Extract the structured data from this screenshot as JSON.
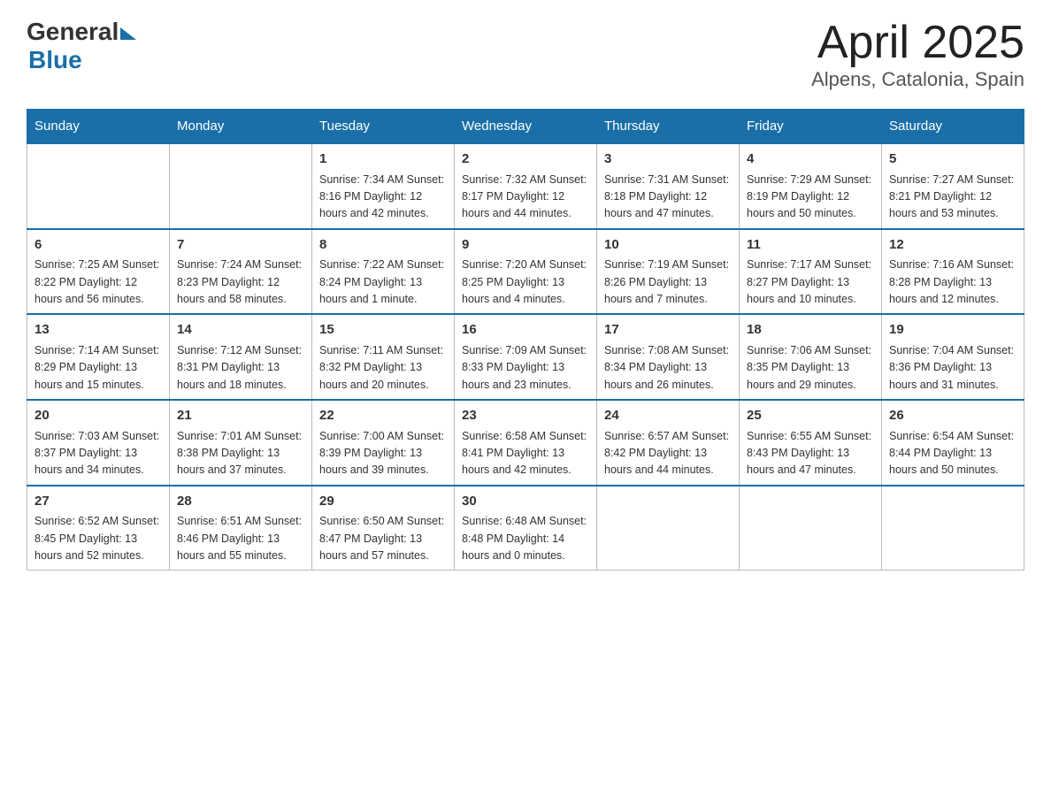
{
  "header": {
    "logo_general": "General",
    "logo_blue": "Blue",
    "title": "April 2025",
    "subtitle": "Alpens, Catalonia, Spain"
  },
  "days_of_week": [
    "Sunday",
    "Monday",
    "Tuesday",
    "Wednesday",
    "Thursday",
    "Friday",
    "Saturday"
  ],
  "weeks": [
    [
      {
        "num": "",
        "info": ""
      },
      {
        "num": "",
        "info": ""
      },
      {
        "num": "1",
        "info": "Sunrise: 7:34 AM\nSunset: 8:16 PM\nDaylight: 12 hours\nand 42 minutes."
      },
      {
        "num": "2",
        "info": "Sunrise: 7:32 AM\nSunset: 8:17 PM\nDaylight: 12 hours\nand 44 minutes."
      },
      {
        "num": "3",
        "info": "Sunrise: 7:31 AM\nSunset: 8:18 PM\nDaylight: 12 hours\nand 47 minutes."
      },
      {
        "num": "4",
        "info": "Sunrise: 7:29 AM\nSunset: 8:19 PM\nDaylight: 12 hours\nand 50 minutes."
      },
      {
        "num": "5",
        "info": "Sunrise: 7:27 AM\nSunset: 8:21 PM\nDaylight: 12 hours\nand 53 minutes."
      }
    ],
    [
      {
        "num": "6",
        "info": "Sunrise: 7:25 AM\nSunset: 8:22 PM\nDaylight: 12 hours\nand 56 minutes."
      },
      {
        "num": "7",
        "info": "Sunrise: 7:24 AM\nSunset: 8:23 PM\nDaylight: 12 hours\nand 58 minutes."
      },
      {
        "num": "8",
        "info": "Sunrise: 7:22 AM\nSunset: 8:24 PM\nDaylight: 13 hours\nand 1 minute."
      },
      {
        "num": "9",
        "info": "Sunrise: 7:20 AM\nSunset: 8:25 PM\nDaylight: 13 hours\nand 4 minutes."
      },
      {
        "num": "10",
        "info": "Sunrise: 7:19 AM\nSunset: 8:26 PM\nDaylight: 13 hours\nand 7 minutes."
      },
      {
        "num": "11",
        "info": "Sunrise: 7:17 AM\nSunset: 8:27 PM\nDaylight: 13 hours\nand 10 minutes."
      },
      {
        "num": "12",
        "info": "Sunrise: 7:16 AM\nSunset: 8:28 PM\nDaylight: 13 hours\nand 12 minutes."
      }
    ],
    [
      {
        "num": "13",
        "info": "Sunrise: 7:14 AM\nSunset: 8:29 PM\nDaylight: 13 hours\nand 15 minutes."
      },
      {
        "num": "14",
        "info": "Sunrise: 7:12 AM\nSunset: 8:31 PM\nDaylight: 13 hours\nand 18 minutes."
      },
      {
        "num": "15",
        "info": "Sunrise: 7:11 AM\nSunset: 8:32 PM\nDaylight: 13 hours\nand 20 minutes."
      },
      {
        "num": "16",
        "info": "Sunrise: 7:09 AM\nSunset: 8:33 PM\nDaylight: 13 hours\nand 23 minutes."
      },
      {
        "num": "17",
        "info": "Sunrise: 7:08 AM\nSunset: 8:34 PM\nDaylight: 13 hours\nand 26 minutes."
      },
      {
        "num": "18",
        "info": "Sunrise: 7:06 AM\nSunset: 8:35 PM\nDaylight: 13 hours\nand 29 minutes."
      },
      {
        "num": "19",
        "info": "Sunrise: 7:04 AM\nSunset: 8:36 PM\nDaylight: 13 hours\nand 31 minutes."
      }
    ],
    [
      {
        "num": "20",
        "info": "Sunrise: 7:03 AM\nSunset: 8:37 PM\nDaylight: 13 hours\nand 34 minutes."
      },
      {
        "num": "21",
        "info": "Sunrise: 7:01 AM\nSunset: 8:38 PM\nDaylight: 13 hours\nand 37 minutes."
      },
      {
        "num": "22",
        "info": "Sunrise: 7:00 AM\nSunset: 8:39 PM\nDaylight: 13 hours\nand 39 minutes."
      },
      {
        "num": "23",
        "info": "Sunrise: 6:58 AM\nSunset: 8:41 PM\nDaylight: 13 hours\nand 42 minutes."
      },
      {
        "num": "24",
        "info": "Sunrise: 6:57 AM\nSunset: 8:42 PM\nDaylight: 13 hours\nand 44 minutes."
      },
      {
        "num": "25",
        "info": "Sunrise: 6:55 AM\nSunset: 8:43 PM\nDaylight: 13 hours\nand 47 minutes."
      },
      {
        "num": "26",
        "info": "Sunrise: 6:54 AM\nSunset: 8:44 PM\nDaylight: 13 hours\nand 50 minutes."
      }
    ],
    [
      {
        "num": "27",
        "info": "Sunrise: 6:52 AM\nSunset: 8:45 PM\nDaylight: 13 hours\nand 52 minutes."
      },
      {
        "num": "28",
        "info": "Sunrise: 6:51 AM\nSunset: 8:46 PM\nDaylight: 13 hours\nand 55 minutes."
      },
      {
        "num": "29",
        "info": "Sunrise: 6:50 AM\nSunset: 8:47 PM\nDaylight: 13 hours\nand 57 minutes."
      },
      {
        "num": "30",
        "info": "Sunrise: 6:48 AM\nSunset: 8:48 PM\nDaylight: 14 hours\nand 0 minutes."
      },
      {
        "num": "",
        "info": ""
      },
      {
        "num": "",
        "info": ""
      },
      {
        "num": "",
        "info": ""
      }
    ]
  ]
}
